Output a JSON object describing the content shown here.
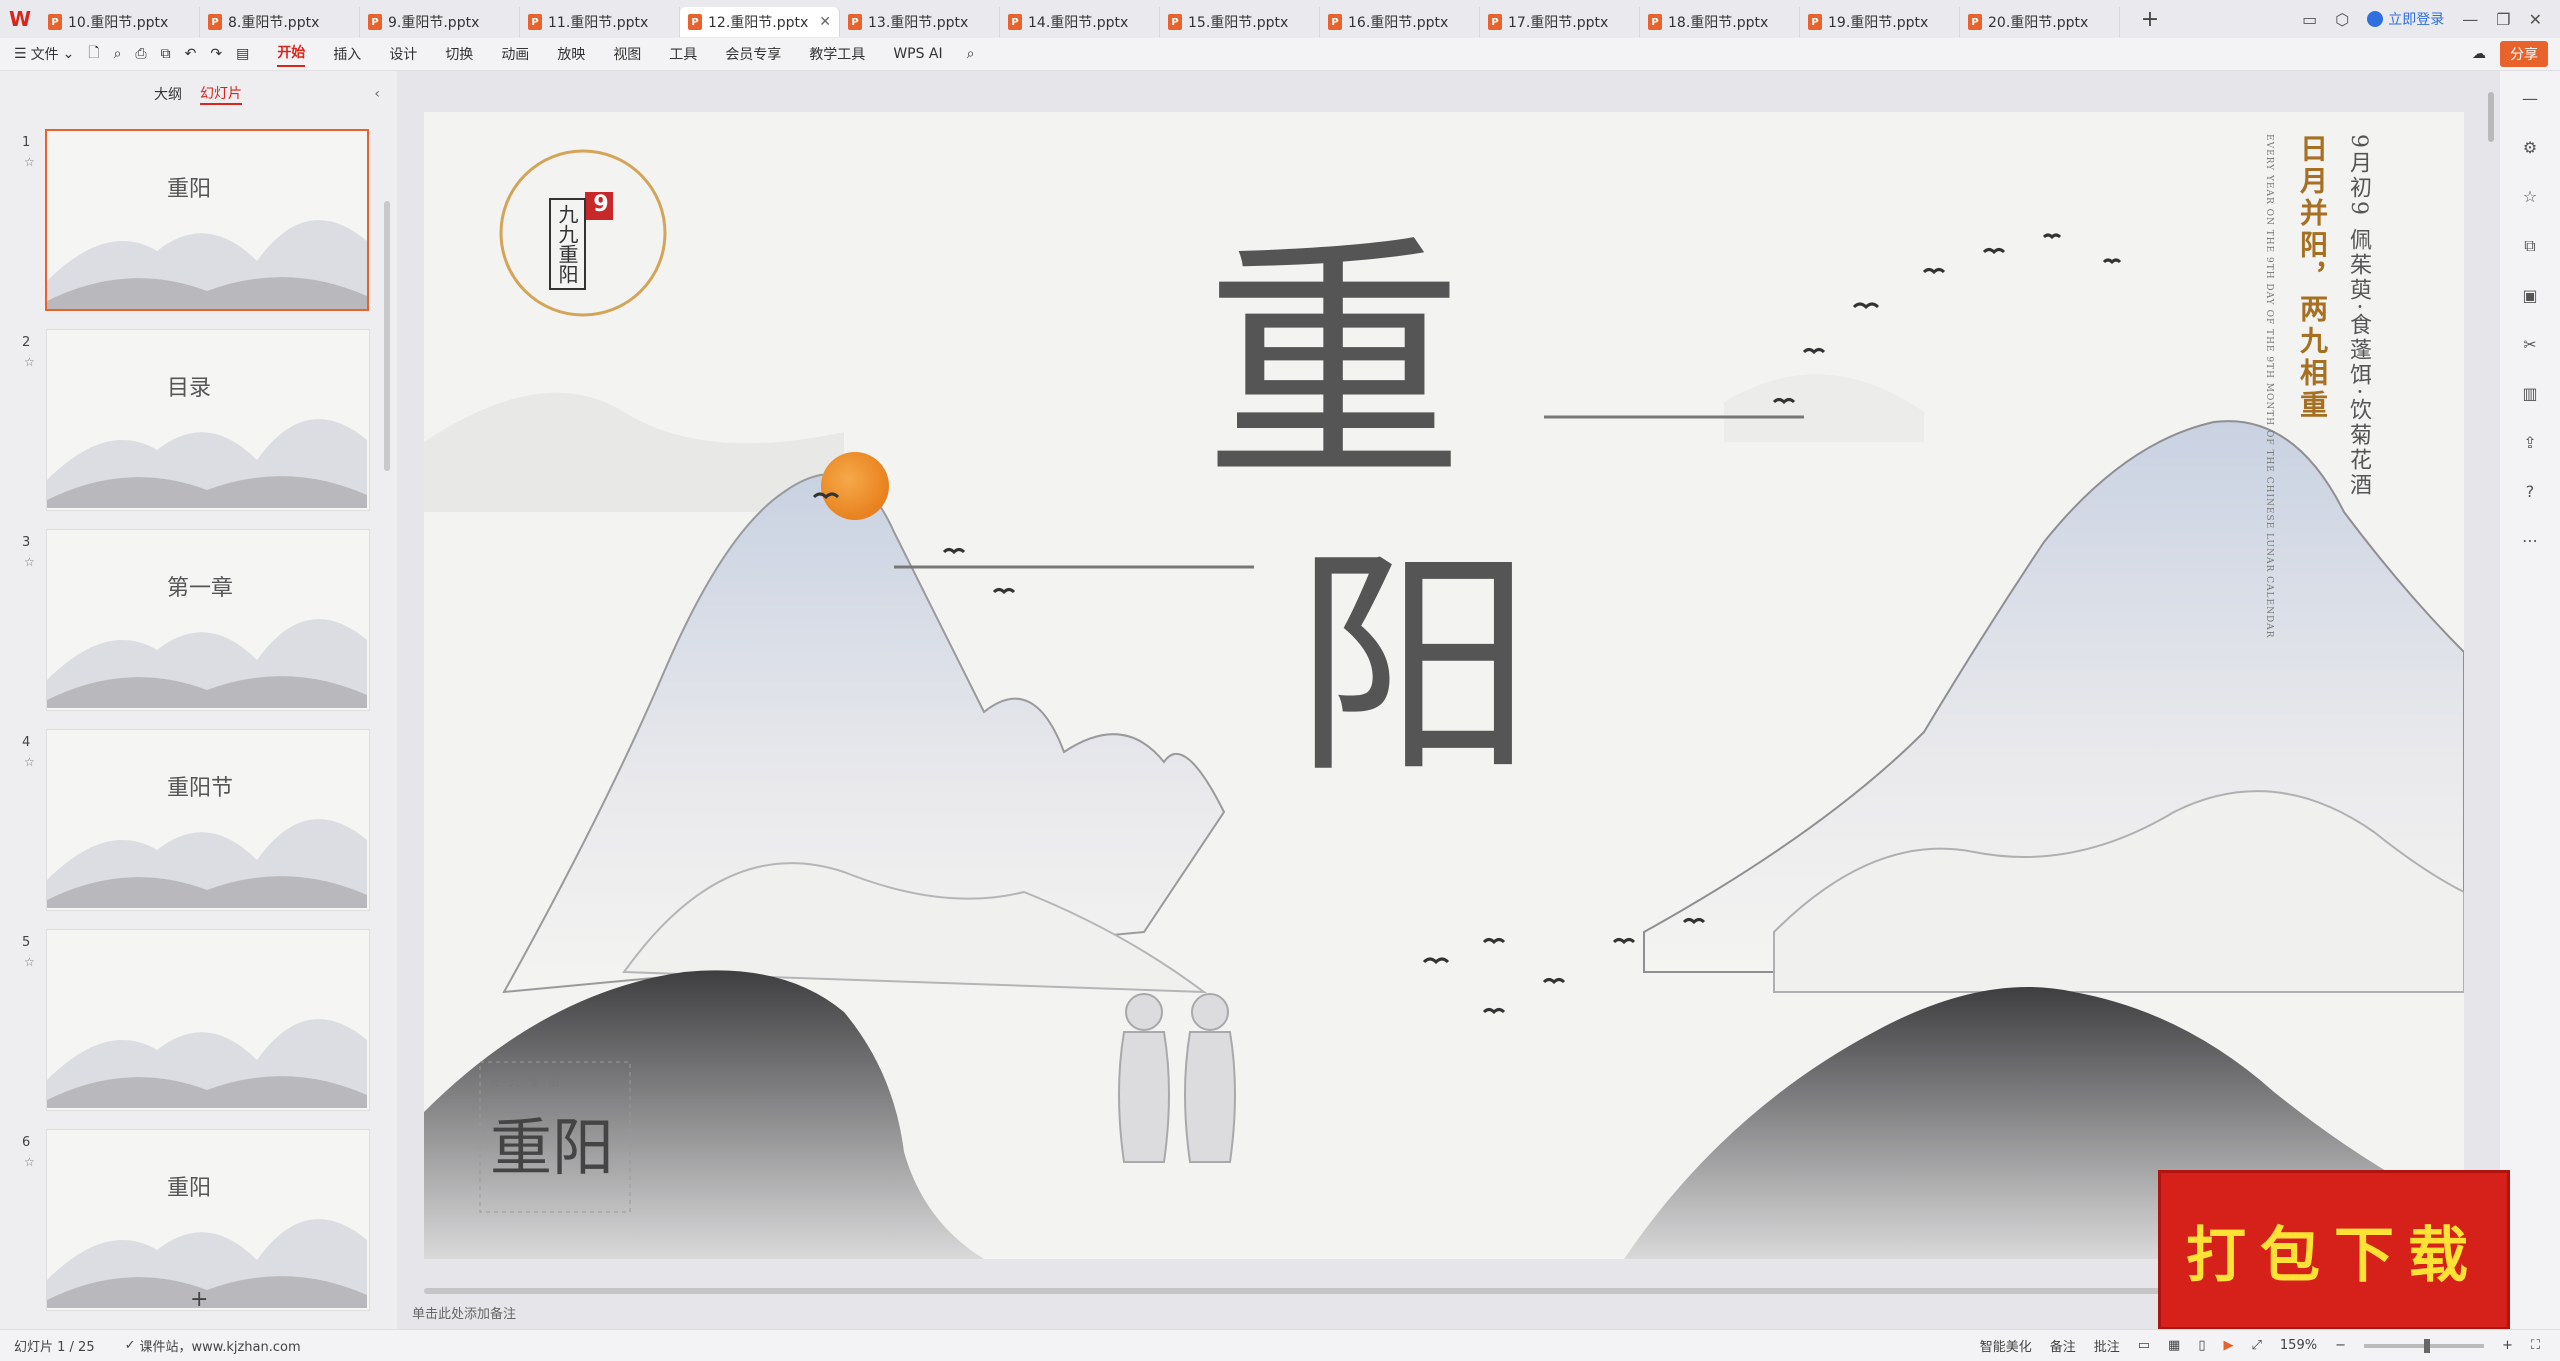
{
  "app": {
    "logo": "W"
  },
  "tabs": [
    {
      "label": "10.重阳节.pptx"
    },
    {
      "label": "8.重阳节.pptx"
    },
    {
      "label": "9.重阳节.pptx"
    },
    {
      "label": "11.重阳节.pptx"
    },
    {
      "label": "12.重阳节.pptx",
      "active": true
    },
    {
      "label": "13.重阳节.pptx"
    },
    {
      "label": "14.重阳节.pptx"
    },
    {
      "label": "15.重阳节.pptx"
    },
    {
      "label": "16.重阳节.pptx"
    },
    {
      "label": "17.重阳节.pptx"
    },
    {
      "label": "18.重阳节.pptx"
    },
    {
      "label": "19.重阳节.pptx"
    },
    {
      "label": "20.重阳节.pptx"
    }
  ],
  "tabbar": {
    "add": "+",
    "login": "立即登录"
  },
  "ribbon": {
    "menu": "文件",
    "tabs": [
      "开始",
      "插入",
      "设计",
      "切换",
      "动画",
      "放映",
      "视图",
      "工具",
      "会员专享",
      "教学工具",
      "WPS AI"
    ],
    "share": "分享"
  },
  "panel": {
    "tab_outline": "大纲",
    "tab_slides": "幻灯片",
    "add": "+"
  },
  "thumbs": [
    {
      "num": "1",
      "title": "重阳"
    },
    {
      "num": "2",
      "title": "目录"
    },
    {
      "num": "3",
      "title": "第一章"
    },
    {
      "num": "4",
      "title": "重阳节"
    },
    {
      "num": "5",
      "title": ""
    },
    {
      "num": "6",
      "title": "重阳"
    }
  ],
  "slide": {
    "badge": "九九重阳",
    "badge_num": "9",
    "title_line1": "重",
    "title_line2": "阳",
    "poem_right1": "9月初9  佩茱萸·食蓬饵·饮菊花酒",
    "poem_right2": "日月并阳，两九相重",
    "poem_en": "EVERY YEAR ON THE 9TH DAY OF THE 9TH MONTH OF THE CHINESE LUNAR CALENDAR",
    "stamp_small": "九 · 九 · 重 · 阳",
    "stamp_big": "重阳"
  },
  "notes": "单击此处添加备注",
  "download_badge": "打包下载",
  "status": {
    "slide_info": "幻灯片 1 / 25",
    "site": "课件站，www.kjzhan.com",
    "beautify": "智能美化",
    "notes": "备注",
    "comments": "批注",
    "zoom": "159%"
  }
}
